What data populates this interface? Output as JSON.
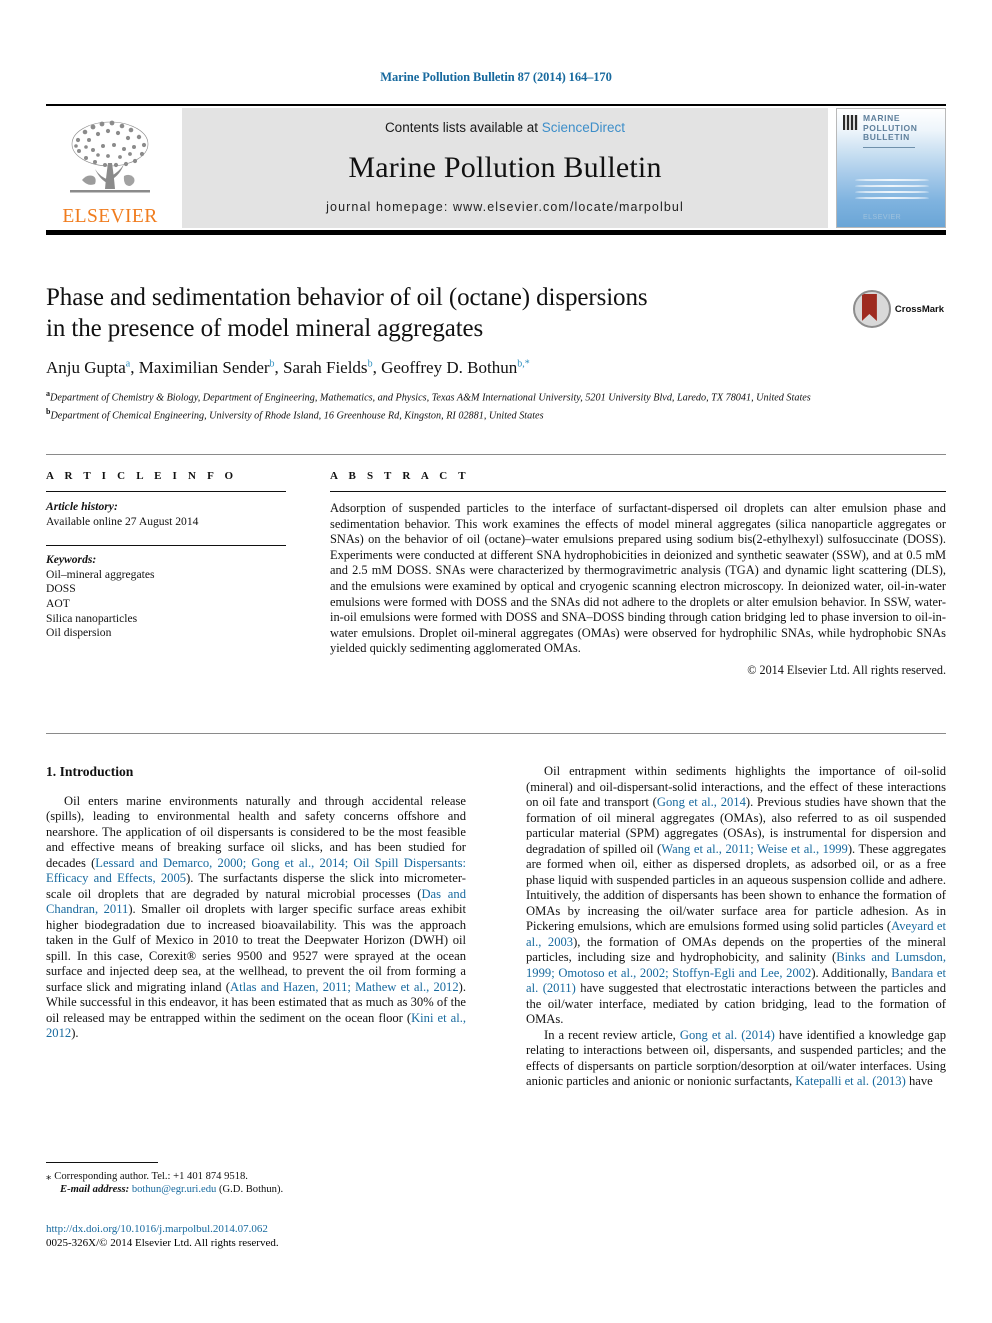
{
  "running_head": "Marine Pollution Bulletin 87 (2014) 164–170",
  "masthead": {
    "elsevier_wordmark": "ELSEVIER",
    "contents_prefix": "Contents lists available at ",
    "sciencedirect": "ScienceDirect",
    "journal_name": "Marine Pollution Bulletin",
    "homepage": "journal homepage: www.elsevier.com/locate/marpolbul",
    "cover_title_lines": [
      "MARINE",
      "POLLUTION",
      "BULLETIN"
    ],
    "cover_footer": "ELSEVIER"
  },
  "article": {
    "title_line1": "Phase and sedimentation behavior of oil (octane) dispersions",
    "title_line2": "in the presence of model mineral aggregates",
    "crossmark_label": "CrossMark",
    "authors": [
      {
        "name": "Anju Gupta",
        "marker": "a",
        "sep": ", "
      },
      {
        "name": "Maximilian Sender",
        "marker": "b",
        "sep": ", "
      },
      {
        "name": "Sarah Fields",
        "marker": "b",
        "sep": ", "
      },
      {
        "name": "Geoffrey D. Bothun",
        "marker": "b,*",
        "sep": ""
      }
    ],
    "affiliations": [
      {
        "marker": "a",
        "text": "Department of Chemistry & Biology, Department of Engineering, Mathematics, and Physics, Texas A&M International University, 5201 University Blvd, Laredo, TX 78041, United States"
      },
      {
        "marker": "b",
        "text": "Department of Chemical Engineering, University of Rhode Island, 16 Greenhouse Rd, Kingston, RI 02881, United States"
      }
    ]
  },
  "article_info": {
    "heading": "A R T I C L E  I N F O",
    "history_label": "Article history:",
    "history_value": "Available online 27 August 2014",
    "keywords_label": "Keywords:",
    "keywords": [
      "Oil–mineral aggregates",
      "DOSS",
      "AOT",
      "Silica nanoparticles",
      "Oil dispersion"
    ]
  },
  "abstract": {
    "heading": "A B S T R A C T",
    "text": "Adsorption of suspended particles to the interface of surfactant-dispersed oil droplets can alter emulsion phase and sedimentation behavior. This work examines the effects of model mineral aggregates (silica nanoparticle aggregates or SNAs) on the behavior of oil (octane)–water emulsions prepared using sodium bis(2-ethylhexyl) sulfosuccinate (DOSS). Experiments were conducted at different SNA hydrophobicities in deionized and synthetic seawater (SSW), and at 0.5 mM and 2.5 mM DOSS. SNAs were characterized by thermogravimetric analysis (TGA) and dynamic light scattering (DLS), and the emulsions were examined by optical and cryogenic scanning electron microscopy. In deionized water, oil-in-water emulsions were formed with DOSS and the SNAs did not adhere to the droplets or alter emulsion behavior. In SSW, water-in-oil emulsions were formed with DOSS and SNA–DOSS binding through cation bridging led to phase inversion to oil-in-water emulsions. Droplet oil-mineral aggregates (OMAs) were observed for hydrophilic SNAs, while hydrophobic SNAs yielded quickly sedimenting agglomerated OMAs.",
    "copyright": "© 2014 Elsevier Ltd. All rights reserved."
  },
  "body": {
    "section_title": "1. Introduction",
    "left_paragraphs": [
      {
        "runs": [
          {
            "t": "Oil enters marine environments naturally and through accidental release (spills), leading to environmental health and safety concerns offshore and nearshore. The application of oil dispersants is considered to be the most feasible and effective means of breaking surface oil slicks, and has been studied for decades (",
            "ref": false
          },
          {
            "t": "Lessard and Demarco, 2000; Gong et al., 2014; Oil Spill Dispersants: Efficacy and Effects, 2005",
            "ref": true
          },
          {
            "t": "). The surfactants disperse the slick into micrometer-scale oil droplets that are degraded by natural microbial processes (",
            "ref": false
          },
          {
            "t": "Das and Chandran, 2011",
            "ref": true
          },
          {
            "t": "). Smaller oil droplets with larger specific surface areas exhibit higher biodegradation due to increased bioavailability. This was the approach taken in the Gulf of Mexico in 2010 to treat the Deepwater Horizon (DWH) oil spill. In this case, Corexit® series 9500 and 9527 were sprayed at the ocean surface and injected deep sea, at the wellhead, to prevent the oil from forming a surface slick and migrating inland (",
            "ref": false
          },
          {
            "t": "Atlas and Hazen, 2011; Mathew et al., 2012",
            "ref": true
          },
          {
            "t": "). While successful in this endeavor, it has been estimated that as much as 30% of the oil released may be entrapped within the sediment on the ocean floor (",
            "ref": false
          },
          {
            "t": "Kini et al., 2012",
            "ref": true
          },
          {
            "t": ").",
            "ref": false
          }
        ]
      }
    ],
    "right_paragraphs": [
      {
        "runs": [
          {
            "t": "Oil entrapment within sediments highlights the importance of oil-solid (mineral) and oil-dispersant-solid interactions, and the effect of these interactions on oil fate and transport (",
            "ref": false
          },
          {
            "t": "Gong et al., 2014",
            "ref": true
          },
          {
            "t": "). Previous studies have shown that the formation of oil mineral aggregates (OMAs), also referred to as oil suspended particular material (SPM) aggregates (OSAs), is instrumental for dispersion and degradation of spilled oil (",
            "ref": false
          },
          {
            "t": "Wang et al., 2011; Weise et al., 1999",
            "ref": true
          },
          {
            "t": "). These aggregates are formed when oil, either as dispersed droplets, as adsorbed oil, or as a free phase liquid with suspended particles in an aqueous suspension collide and adhere. Intuitively, the addition of dispersants has been shown to enhance the formation of OMAs by increasing the oil/water surface area for particle adhesion. As in Pickering emulsions, which are emulsions formed using solid particles (",
            "ref": false
          },
          {
            "t": "Aveyard et al., 2003",
            "ref": true
          },
          {
            "t": "), the formation of OMAs depends on the properties of the mineral particles, including size and hydrophobicity, and salinity (",
            "ref": false
          },
          {
            "t": "Binks and Lumsdon, 1999; Omotoso et al., 2002; Stoffyn-Egli and Lee, 2002",
            "ref": true
          },
          {
            "t": "). Additionally, ",
            "ref": false
          },
          {
            "t": "Bandara et al. (2011)",
            "ref": true
          },
          {
            "t": " have suggested that electrostatic interactions between the particles and the oil/water interface, mediated by cation bridging, lead to the formation of OMAs.",
            "ref": false
          }
        ]
      },
      {
        "runs": [
          {
            "t": "In a recent review article, ",
            "ref": false
          },
          {
            "t": "Gong et al. (2014)",
            "ref": true
          },
          {
            "t": " have identified a knowledge gap relating to interactions between oil, dispersants, and suspended particles; and the effects of dispersants on particle sorption/desorption at oil/water interfaces. Using anionic particles and anionic or nonionic surfactants, ",
            "ref": false
          },
          {
            "t": "Katepalli et al. (2013)",
            "ref": true
          },
          {
            "t": " have",
            "ref": false
          }
        ]
      }
    ]
  },
  "footer": {
    "corresponding_star": "⁎",
    "corresponding_text": "Corresponding author. Tel.: +1 401 874 9518.",
    "email_label": "E-mail address:",
    "email": "bothun@egr.uri.edu",
    "email_owner": "(G.D. Bothun).",
    "doi": "http://dx.doi.org/10.1016/j.marpolbul.2014.07.062",
    "issn_line": "0025-326X/© 2014 Elsevier Ltd. All rights reserved."
  },
  "colors": {
    "link": "#17699e",
    "sciencedirect": "#3d8ec9",
    "elsevier_orange": "#f07c1e",
    "author_marker": "#2e8fbf"
  }
}
